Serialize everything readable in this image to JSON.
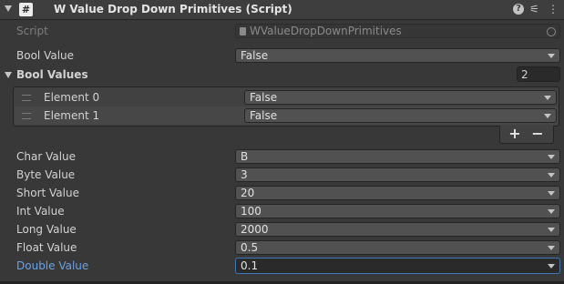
{
  "component": {
    "title": "W Value Drop Down Primitives (Script)",
    "icons": [
      "arrow-down-icon",
      "script-hash-icon",
      "help-icon",
      "presets-icon",
      "more-icon"
    ]
  },
  "script": {
    "label": "Script",
    "value": "WValueDropDownPrimitives"
  },
  "bool_value": {
    "label": "Bool Value",
    "value": "False"
  },
  "bool_values": {
    "label": "Bool Values",
    "size": "2",
    "elements": [
      {
        "label": "Element 0",
        "value": "False"
      },
      {
        "label": "Element 1",
        "value": "False"
      }
    ],
    "add_label": "+",
    "remove_label": "−"
  },
  "fields": [
    {
      "label": "Char Value",
      "value": "B"
    },
    {
      "label": "Byte Value",
      "value": "3"
    },
    {
      "label": "Short Value",
      "value": "20"
    },
    {
      "label": "Int Value",
      "value": "100"
    },
    {
      "label": "Long Value",
      "value": "2000"
    },
    {
      "label": "Float Value",
      "value": "0.5"
    },
    {
      "label": "Double Value",
      "value": "0.1"
    }
  ],
  "colors": {
    "background": "#383838",
    "header": "#3e3e3e",
    "focus": "#3a79bb",
    "focus_label": "#6ea1e3"
  }
}
